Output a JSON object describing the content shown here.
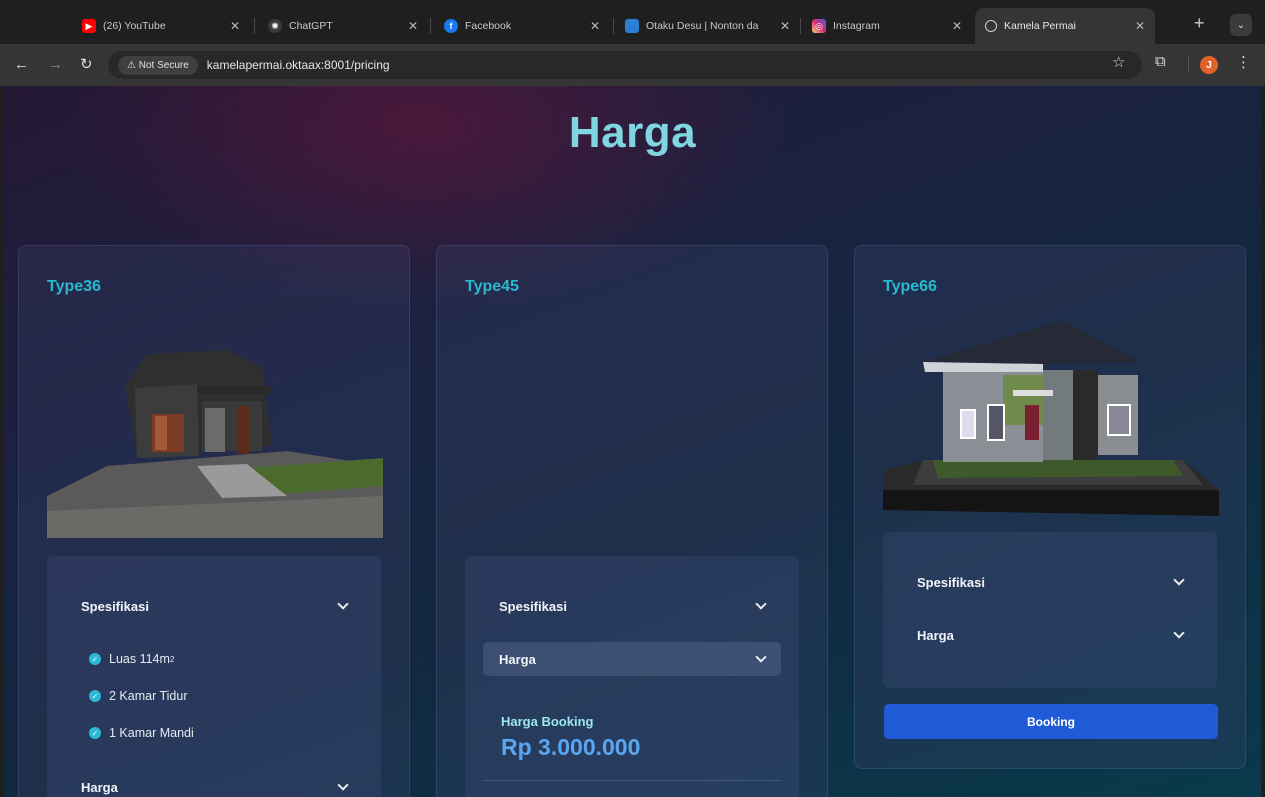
{
  "browser": {
    "tabs": [
      {
        "label": "(26) YouTube",
        "icon": "youtube-icon",
        "color": "#ff0000"
      },
      {
        "label": "ChatGPT",
        "icon": "chatgpt-icon",
        "color": "#3a3a3a"
      },
      {
        "label": "Facebook",
        "icon": "facebook-icon",
        "color": "#1877f2"
      },
      {
        "label": "Otaku Desu | Nonton da",
        "icon": "otakudesu-icon",
        "color": "#2a7fd4"
      },
      {
        "label": "Instagram",
        "icon": "instagram-icon",
        "color": "#d62976"
      },
      {
        "label": "Kamela Permai",
        "icon": "globe-icon",
        "color": "#353535"
      }
    ],
    "active_tab": 5,
    "security_badge": "⚠ Not Secure",
    "url": "kamelapermai.oktaax:8001/pricing",
    "avatar_initial": "J"
  },
  "page": {
    "title": "Harga",
    "accent_color": "#27b9cf",
    "button_color": "#1f5bd7",
    "cards": [
      {
        "title": "Type36",
        "spec_label": "Spesifikasi",
        "spec_items": [
          {
            "text": "Luas 114m",
            "sup": "2"
          },
          {
            "text": "2 Kamar Tidur"
          },
          {
            "text": "1 Kamar Mandi"
          }
        ],
        "price_label": "Harga"
      },
      {
        "title": "Type45",
        "spec_label": "Spesifikasi",
        "price_label": "Harga",
        "booking_label": "Harga Booking",
        "booking_price": "Rp 3.000.000"
      },
      {
        "title": "Type66",
        "spec_label": "Spesifikasi",
        "price_label": "Harga",
        "button_label": "Booking"
      }
    ]
  }
}
